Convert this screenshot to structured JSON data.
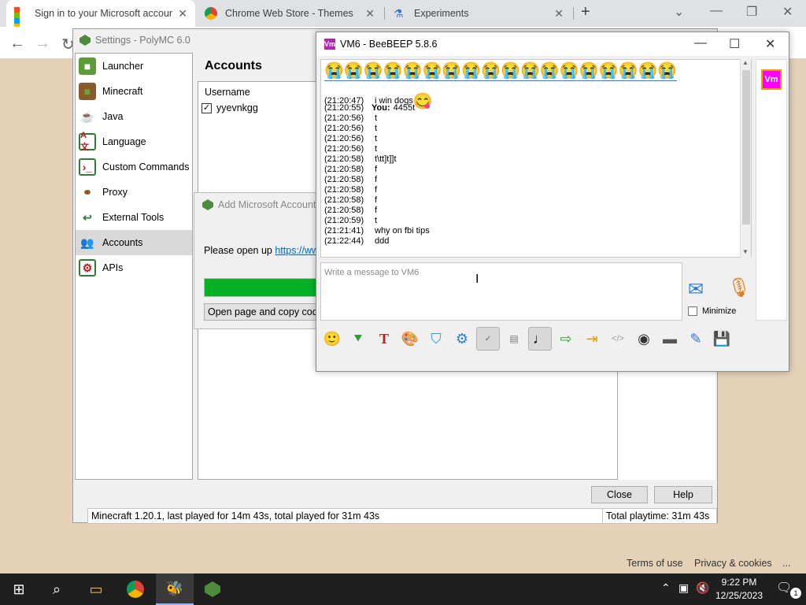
{
  "browser": {
    "tabs": [
      {
        "label": "Sign in to your Microsoft accour",
        "active": true
      },
      {
        "label": "Chrome Web Store - Themes",
        "active": false
      },
      {
        "label": "Experiments",
        "active": false
      }
    ],
    "new_tab": "+",
    "footer": {
      "terms": "Terms of use",
      "privacy": "Privacy & cookies",
      "more": "..."
    }
  },
  "polymc": {
    "title": "Settings - PolyMC 6.0",
    "heading": "Accounts",
    "sidebar": [
      {
        "label": "Launcher",
        "icon": "grass-block-icon"
      },
      {
        "label": "Minecraft",
        "icon": "dirt-block-icon"
      },
      {
        "label": "Java",
        "icon": "java-cup-icon"
      },
      {
        "label": "Language",
        "icon": "language-icon"
      },
      {
        "label": "Custom Commands",
        "icon": "terminal-icon"
      },
      {
        "label": "Proxy",
        "icon": "proxy-icon"
      },
      {
        "label": "External Tools",
        "icon": "tools-icon"
      },
      {
        "label": "Accounts",
        "icon": "accounts-icon",
        "selected": true
      },
      {
        "label": "APIs",
        "icon": "api-icon"
      }
    ],
    "table": {
      "column": "Username",
      "rows": [
        {
          "username": "yyevnkgg",
          "checked": true
        }
      ]
    },
    "buttons": {
      "close": "Close",
      "help": "Help"
    },
    "status": {
      "left": "Minecraft 1.20.1, last played for 14m 43s, total played for 31m 43s",
      "right": "Total playtime: 31m 43s"
    }
  },
  "add_ms_account": {
    "title": "Add Microsoft Account",
    "prompt": "Please open up ",
    "link": "https://www",
    "button": "Open page and copy code",
    "progress_fraction": 1.0
  },
  "beebeep": {
    "title": "VM6 - BeeBEEP 5.8.6",
    "badge": "Vm",
    "emoji_row": "😭😭😭😭😭😭😭😭😭😭😭😭😭😭😭😭😭😭",
    "messages": [
      {
        "time": "(21:20:47)",
        "user": "",
        "text": "i win dogs",
        "emoji": "😋"
      },
      {
        "time": "(21:20:55)",
        "user": "You:",
        "text": "4455t"
      },
      {
        "time": "(21:20:56)",
        "user": "",
        "text": "t"
      },
      {
        "time": "(21:20:56)",
        "user": "",
        "text": "t"
      },
      {
        "time": "(21:20:56)",
        "user": "",
        "text": "t"
      },
      {
        "time": "(21:20:56)",
        "user": "",
        "text": "t"
      },
      {
        "time": "(21:20:58)",
        "user": "",
        "text": "t\\tt]t]]t"
      },
      {
        "time": "(21:20:58)",
        "user": "",
        "text": "f"
      },
      {
        "time": "(21:20:58)",
        "user": "",
        "text": "f"
      },
      {
        "time": "(21:20:58)",
        "user": "",
        "text": "f"
      },
      {
        "time": "(21:20:58)",
        "user": "",
        "text": "f"
      },
      {
        "time": "(21:20:58)",
        "user": "",
        "text": "f"
      },
      {
        "time": "(21:20:59)",
        "user": "",
        "text": "t"
      },
      {
        "time": "(21:21:41)",
        "user": "",
        "text": "why on fbi tips"
      },
      {
        "time": "(21:22:44)",
        "user": "",
        "text": "ddd"
      }
    ],
    "input_placeholder": "Write a message to VM6",
    "minimize_label": "Minimize",
    "avatar": "Vm"
  },
  "taskbar": {
    "time": "9:22 PM",
    "date": "12/25/2023",
    "notifications": "1"
  },
  "colors": {
    "progress": "#06b025",
    "accent": "#b026b0"
  }
}
